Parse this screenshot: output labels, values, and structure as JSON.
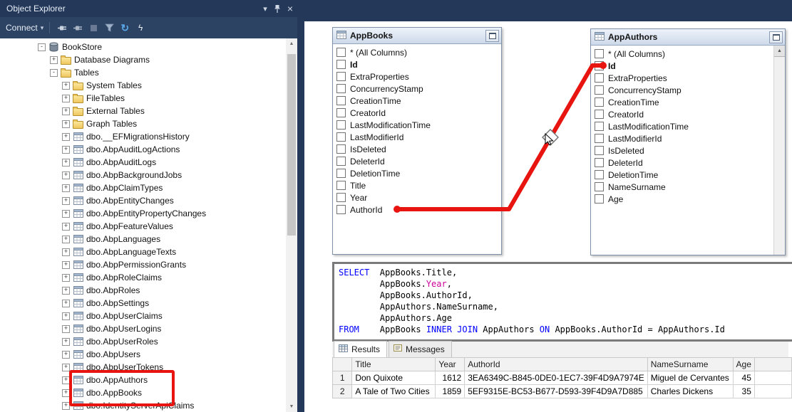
{
  "colors": {
    "annotation_red": "#e8140f",
    "navy": "#24395a",
    "navy_light": "#2c4363",
    "sql_keyword": "#0000ff",
    "sql_function": "#cc0099"
  },
  "object_explorer": {
    "title": "Object Explorer",
    "titlebar": {
      "chevron": "▾",
      "close": "×"
    },
    "toolbar": {
      "connect_label": "Connect",
      "chevron": "▾",
      "refresh_glyph": "↻",
      "spark_glyph": "ϟ"
    },
    "tree": {
      "items": [
        {
          "label": "BookStore",
          "level": 0,
          "expander": "-",
          "icon": "database"
        },
        {
          "label": "Database Diagrams",
          "level": 1,
          "expander": "+",
          "icon": "folder"
        },
        {
          "label": "Tables",
          "level": 1,
          "expander": "-",
          "icon": "folder"
        },
        {
          "label": "System Tables",
          "level": 2,
          "expander": "+",
          "icon": "folder"
        },
        {
          "label": "FileTables",
          "level": 2,
          "expander": "+",
          "icon": "folder"
        },
        {
          "label": "External Tables",
          "level": 2,
          "expander": "+",
          "icon": "folder"
        },
        {
          "label": "Graph Tables",
          "level": 2,
          "expander": "+",
          "icon": "folder"
        },
        {
          "label": "dbo.__EFMigrationsHistory",
          "level": 2,
          "expander": "+",
          "icon": "table"
        },
        {
          "label": "dbo.AbpAuditLogActions",
          "level": 2,
          "expander": "+",
          "icon": "table"
        },
        {
          "label": "dbo.AbpAuditLogs",
          "level": 2,
          "expander": "+",
          "icon": "table"
        },
        {
          "label": "dbo.AbpBackgroundJobs",
          "level": 2,
          "expander": "+",
          "icon": "table"
        },
        {
          "label": "dbo.AbpClaimTypes",
          "level": 2,
          "expander": "+",
          "icon": "table"
        },
        {
          "label": "dbo.AbpEntityChanges",
          "level": 2,
          "expander": "+",
          "icon": "table"
        },
        {
          "label": "dbo.AbpEntityPropertyChanges",
          "level": 2,
          "expander": "+",
          "icon": "table"
        },
        {
          "label": "dbo.AbpFeatureValues",
          "level": 2,
          "expander": "+",
          "icon": "table"
        },
        {
          "label": "dbo.AbpLanguages",
          "level": 2,
          "expander": "+",
          "icon": "table"
        },
        {
          "label": "dbo.AbpLanguageTexts",
          "level": 2,
          "expander": "+",
          "icon": "table"
        },
        {
          "label": "dbo.AbpPermissionGrants",
          "level": 2,
          "expander": "+",
          "icon": "table"
        },
        {
          "label": "dbo.AbpRoleClaims",
          "level": 2,
          "expander": "+",
          "icon": "table"
        },
        {
          "label": "dbo.AbpRoles",
          "level": 2,
          "expander": "+",
          "icon": "table"
        },
        {
          "label": "dbo.AbpSettings",
          "level": 2,
          "expander": "+",
          "icon": "table"
        },
        {
          "label": "dbo.AbpUserClaims",
          "level": 2,
          "expander": "+",
          "icon": "table"
        },
        {
          "label": "dbo.AbpUserLogins",
          "level": 2,
          "expander": "+",
          "icon": "table"
        },
        {
          "label": "dbo.AbpUserRoles",
          "level": 2,
          "expander": "+",
          "icon": "table"
        },
        {
          "label": "dbo.AbpUsers",
          "level": 2,
          "expander": "+",
          "icon": "table"
        },
        {
          "label": "dbo.AbpUserTokens",
          "level": 2,
          "expander": "+",
          "icon": "table"
        },
        {
          "label": "dbo.AppAuthors",
          "level": 2,
          "expander": "+",
          "icon": "table",
          "highlight": true
        },
        {
          "label": "dbo.AppBooks",
          "level": 2,
          "expander": "+",
          "icon": "table",
          "highlight": true
        },
        {
          "label": "dbo.IdentityServerApiClaims",
          "level": 2,
          "expander": "+",
          "icon": "table"
        }
      ]
    }
  },
  "designer": {
    "tables": [
      {
        "name": "AppBooks",
        "columns": [
          {
            "label": "* (All Columns)"
          },
          {
            "label": "Id",
            "bold": true
          },
          {
            "label": "ExtraProperties"
          },
          {
            "label": "ConcurrencyStamp"
          },
          {
            "label": "CreationTime"
          },
          {
            "label": "CreatorId"
          },
          {
            "label": "LastModificationTime"
          },
          {
            "label": "LastModifierId"
          },
          {
            "label": "IsDeleted"
          },
          {
            "label": "DeleterId"
          },
          {
            "label": "DeletionTime"
          },
          {
            "label": "Title"
          },
          {
            "label": "Year"
          },
          {
            "label": "AuthorId"
          }
        ]
      },
      {
        "name": "AppAuthors",
        "columns": [
          {
            "label": "* (All Columns)"
          },
          {
            "label": "Id",
            "bold": true
          },
          {
            "label": "ExtraProperties"
          },
          {
            "label": "ConcurrencyStamp"
          },
          {
            "label": "CreationTime"
          },
          {
            "label": "CreatorId"
          },
          {
            "label": "LastModificationTime"
          },
          {
            "label": "LastModifierId"
          },
          {
            "label": "IsDeleted"
          },
          {
            "label": "DeleterId"
          },
          {
            "label": "DeletionTime"
          },
          {
            "label": "NameSurname"
          },
          {
            "label": "Age"
          }
        ]
      }
    ]
  },
  "sql": {
    "lines": [
      [
        {
          "t": "SELECT",
          "c": "kw"
        },
        {
          "t": "  AppBooks.Title,",
          "c": "pl"
        }
      ],
      [
        {
          "t": "        AppBooks.",
          "c": "pl"
        },
        {
          "t": "Year",
          "c": "fn"
        },
        {
          "t": ",",
          "c": "pl"
        }
      ],
      [
        {
          "t": "        AppBooks.AuthorId,",
          "c": "pl"
        }
      ],
      [
        {
          "t": "        AppAuthors.NameSurname,",
          "c": "pl"
        }
      ],
      [
        {
          "t": "        AppAuthors.Age",
          "c": "pl"
        }
      ],
      [
        {
          "t": "FROM",
          "c": "kw"
        },
        {
          "t": "    AppBooks ",
          "c": "pl"
        },
        {
          "t": "INNER JOIN",
          "c": "kw"
        },
        {
          "t": " AppAuthors ",
          "c": "pl"
        },
        {
          "t": "ON",
          "c": "kw"
        },
        {
          "t": " AppBooks.AuthorId = AppAuthors.Id",
          "c": "pl"
        }
      ]
    ]
  },
  "results": {
    "tabs": [
      {
        "label": "Results"
      },
      {
        "label": "Messages"
      }
    ],
    "grid": {
      "columns": [
        {
          "label": "Title",
          "align": "left"
        },
        {
          "label": "Year",
          "align": "right"
        },
        {
          "label": "AuthorId",
          "align": "left"
        },
        {
          "label": "NameSurname",
          "align": "left"
        },
        {
          "label": "Age",
          "align": "right"
        }
      ],
      "rows": [
        {
          "num": "1",
          "cells": [
            "Don Quixote",
            "1612",
            "3EA6349C-B845-0DE0-1EC7-39F4D9A7974E",
            "Miguel de Cervantes",
            "45"
          ]
        },
        {
          "num": "2",
          "cells": [
            "A Tale of Two Cities",
            "1859",
            "5EF9315E-BC53-B677-D593-39F4D9A7D885",
            "Charles Dickens",
            "35"
          ]
        }
      ]
    }
  }
}
